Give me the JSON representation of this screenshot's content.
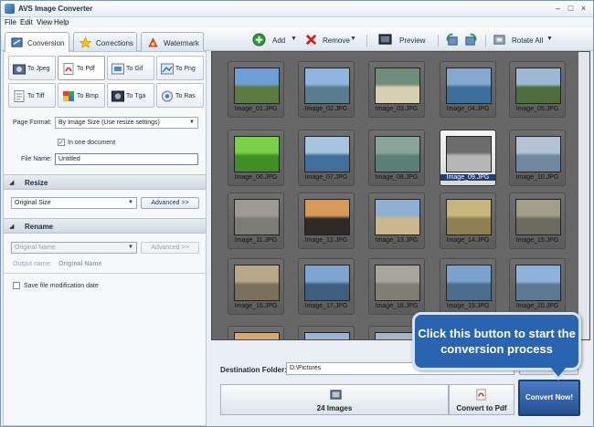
{
  "window": {
    "title": "AVS Image Converter"
  },
  "menu": [
    "File",
    "Edit",
    "View",
    "Help"
  ],
  "tabs": [
    {
      "label": "Conversion",
      "icon": "conversion-icon",
      "active": true
    },
    {
      "label": "Corrections",
      "icon": "star-icon",
      "active": false
    },
    {
      "label": "Watermark",
      "icon": "watermark-icon",
      "active": false
    }
  ],
  "toolbar": {
    "add_label": "Add",
    "remove_label": "Remove",
    "preview_label": "Preview",
    "rotate_all_label": "Rotate All"
  },
  "formats": [
    {
      "label": "To Jpeg",
      "icon": "jpeg-icon",
      "active": false
    },
    {
      "label": "To Pdf",
      "icon": "pdf-icon",
      "active": true
    },
    {
      "label": "To Gif",
      "icon": "gif-icon",
      "active": false
    },
    {
      "label": "To Png",
      "icon": "png-icon",
      "active": false
    },
    {
      "label": "To Tiff",
      "icon": "tiff-icon",
      "active": false
    },
    {
      "label": "To Bmp",
      "icon": "bmp-icon",
      "active": false
    },
    {
      "label": "To Tga",
      "icon": "tga-icon",
      "active": false
    },
    {
      "label": "To Ras",
      "icon": "ras-icon",
      "active": false
    }
  ],
  "settings": {
    "page_format_label": "Page Format:",
    "page_format_value": "By Image Size (Use resize settings)",
    "one_document_label": "In one document",
    "one_document_checked": true,
    "file_name_label": "File Name:",
    "file_name_value": "Untitled"
  },
  "resize": {
    "title": "Resize",
    "size_value": "Original Size",
    "advanced_label": "Advanced >>"
  },
  "rename": {
    "title": "Rename",
    "name_placeholder": "Original Name",
    "advanced_label": "Advanced >>",
    "output_name_label": "Output name:",
    "output_name_value": "Original Name"
  },
  "save_date": {
    "label": "Save file modification date",
    "checked": false
  },
  "images": [
    {
      "name": "Image_01.JPG",
      "selected": false,
      "colors": [
        "#6d9ed8",
        "#5d7a3f"
      ]
    },
    {
      "name": "Image_02.JPG",
      "selected": false,
      "colors": [
        "#8fb5e0",
        "#597d8c"
      ]
    },
    {
      "name": "Image_03.JPG",
      "selected": false,
      "colors": [
        "#6f8d7b",
        "#d8cfb0"
      ]
    },
    {
      "name": "Image_04.JPG",
      "selected": false,
      "colors": [
        "#85a7d0",
        "#3e6f9c"
      ]
    },
    {
      "name": "Image_05.JPG",
      "selected": false,
      "colors": [
        "#9db8d4",
        "#4f6e3d"
      ]
    },
    {
      "name": "Image_06.JPG",
      "selected": false,
      "colors": [
        "#7bd04a",
        "#3f8f24"
      ]
    },
    {
      "name": "Image_07.JPG",
      "selected": false,
      "colors": [
        "#a8c3dc",
        "#3f6f9a"
      ]
    },
    {
      "name": "Image_08.JPG",
      "selected": false,
      "colors": [
        "#8aa49a",
        "#5b7f76"
      ]
    },
    {
      "name": "Image_09.JPG",
      "selected": true,
      "colors": [
        "#6d6d6d",
        "#b6b6b6"
      ]
    },
    {
      "name": "Image_10.JPG",
      "selected": false,
      "colors": [
        "#b4c3d4",
        "#6f879f"
      ]
    },
    {
      "name": "Image_11.JPG",
      "selected": false,
      "colors": [
        "#9b9b94",
        "#7c7c76"
      ]
    },
    {
      "name": "Image_12.JPG",
      "selected": false,
      "colors": [
        "#d89a5a",
        "#2e2a2a"
      ]
    },
    {
      "name": "Image_13.JPG",
      "selected": false,
      "colors": [
        "#8fb0d2",
        "#cbb78e"
      ]
    },
    {
      "name": "Image_14.JPG",
      "selected": false,
      "colors": [
        "#c6b67c",
        "#8e8052"
      ]
    },
    {
      "name": "Image_15.JPG",
      "selected": false,
      "colors": [
        "#a29e8a",
        "#6c6a5e"
      ]
    },
    {
      "name": "Image_16.JPG",
      "selected": false,
      "colors": [
        "#b7a887",
        "#7b705b"
      ]
    },
    {
      "name": "Image_17.JPG",
      "selected": false,
      "colors": [
        "#7ea4cf",
        "#3e5f7d"
      ]
    },
    {
      "name": "Image_18.JPG",
      "selected": false,
      "colors": [
        "#a8a69c",
        "#7f7d74"
      ]
    },
    {
      "name": "Image_19.JPG",
      "selected": false,
      "colors": [
        "#7aa2cf",
        "#4a6e8c"
      ]
    },
    {
      "name": "Image_20.JPG",
      "selected": false,
      "colors": [
        "#8fb2d9",
        "#5c7a94"
      ]
    },
    {
      "name": "",
      "selected": false,
      "colors": [
        "#d9a870",
        "#8d7a66"
      ]
    },
    {
      "name": "",
      "selected": false,
      "colors": [
        "#9ab6d6",
        "#6a86a0"
      ]
    },
    {
      "name": "",
      "selected": false,
      "colors": [
        "#a6b7c9",
        "#7d8f9f"
      ]
    },
    {
      "name": "",
      "selected": false,
      "colors": [
        "#b8b8b0",
        "#8f8f88"
      ]
    }
  ],
  "destination": {
    "label": "Destination Folder:",
    "value": "D:\\Pictures"
  },
  "bottom": {
    "images_count_label": "24 Images",
    "convert_to_label": "Convert to Pdf",
    "convert_now_label": "Convert Now!"
  },
  "callout": {
    "text": "Click this button to start the conversion process"
  },
  "colors": {
    "accent": "#2a64b0",
    "grid_bg": "#676767"
  }
}
